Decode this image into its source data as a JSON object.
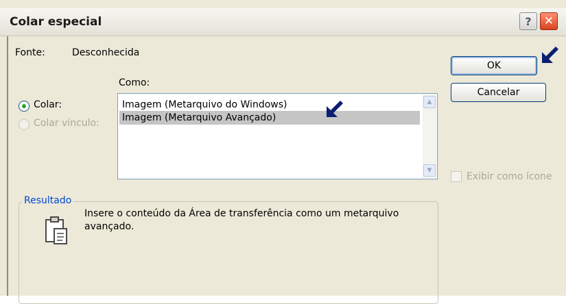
{
  "dialog": {
    "title": "Colar especial",
    "help_glyph": "?",
    "close_glyph": "✕",
    "source_label": "Fonte:",
    "source_value": "Desconhecida",
    "as_label": "Como:",
    "paste_option": "Colar:",
    "paste_link_option": "Colar vínculo:",
    "formats": [
      "Imagem (Metarquivo do Windows)",
      "Imagem (Metarquivo Avançado)"
    ],
    "selected_format_index": 1,
    "ok_label": "OK",
    "cancel_label": "Cancelar",
    "display_as_icon_label": "Exibir como ícone",
    "result": {
      "legend": "Resultado",
      "line1": "Insere o conteúdo da Área de transferência como um metarquivo",
      "line2": "avançado."
    },
    "icons": {
      "result": "clipboard-icon",
      "annotation": "arrow-pointer-icon"
    },
    "colors": {
      "accent": "#0046d5",
      "arrow": "#0a1f73",
      "selection": "#c5c5c5"
    }
  }
}
